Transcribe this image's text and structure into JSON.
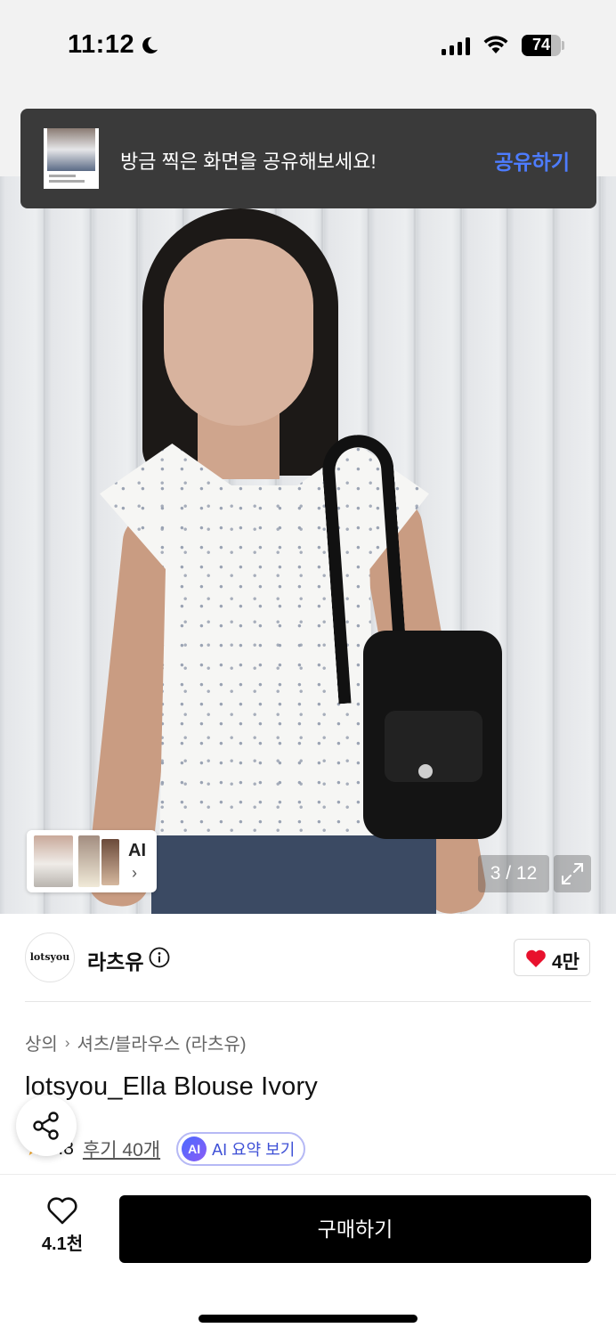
{
  "status_bar": {
    "time": "11:12",
    "battery": "74",
    "battery_level": 0.74
  },
  "toast": {
    "message": "방금 찍은 화면을 공유해보세요!",
    "action": "공유하기"
  },
  "gallery": {
    "ai_label": "AI",
    "ai_chevron": "›",
    "counter": "3 / 12"
  },
  "brand": {
    "logo_text": "lotsyou",
    "name": "라츠유",
    "likes": "4만"
  },
  "product": {
    "breadcrumb": [
      "상의",
      "셔츠/블라우스 (라츠유)"
    ],
    "breadcrumb_sep": "›",
    "title": "lotsyou_Ella Blouse Ivory",
    "rating": "4.8",
    "reviews": "후기 40개",
    "ai_badge": "AI",
    "ai_summary": "AI 요약 보기"
  },
  "bottom_bar": {
    "wish_count": "4.1천",
    "buy_label": "구매하기"
  },
  "colors": {
    "accent_blue": "#4d7cff",
    "heart_red": "#e8112d",
    "ai_purple": "#3d4fd6",
    "primary": "#000000"
  }
}
